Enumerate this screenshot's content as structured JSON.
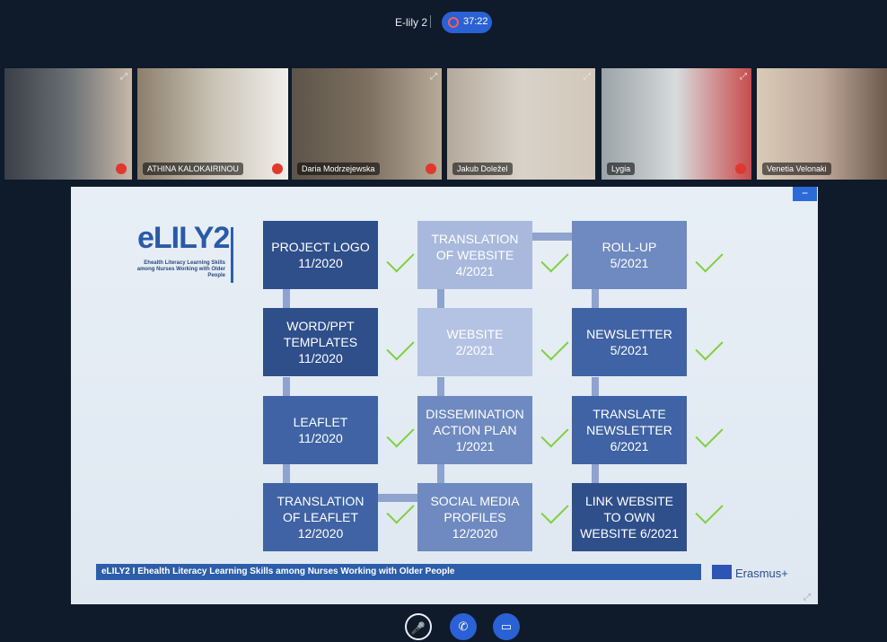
{
  "meeting": {
    "title": "E-lily 2",
    "timer": "37:22"
  },
  "participants": [
    {
      "name": "",
      "has_mic_muted": true
    },
    {
      "name": "ATHINA KALOKAIRINOU",
      "has_mic_muted": true
    },
    {
      "name": "Daria Modrzejewska",
      "has_mic_muted": true
    },
    {
      "name": "Jakub Doležel",
      "has_mic_muted": false
    },
    {
      "name": "Lygia",
      "has_mic_muted": true
    },
    {
      "name": "Venetia Velonaki",
      "has_mic_muted": false
    }
  ],
  "slide": {
    "logo_text": "eLILY2",
    "logo_tagline": "Ehealth Literacy Learning Skills among Nurses Working with Older People",
    "boxes": [
      "PROJECT LOGO\n11/2020",
      "TRANSLATION\nOF WEBSITE\n4/2021",
      "ROLL-UP\n5/2021",
      "WORD/PPT\nTEMPLATES\n11/2020",
      "WEBSITE\n2/2021",
      "NEWSLETTER\n5/2021",
      "LEAFLET\n11/2020",
      "DISSEMINATION\nACTION PLAN\n1/2021",
      "TRANSLATE\nNEWSLETTER\n6/2021",
      "TRANSLATION\nOF LEAFLET\n12/2020",
      "SOCIAL MEDIA\nPROFILES\n12/2020",
      "LINK WEBSITE\nTO OWN\nWEBSITE 6/2021"
    ],
    "footer": "eLILY2 I  Ehealth Literacy Learning Skills among Nurses Working with Older People",
    "erasmus": "Erasmus+"
  },
  "controls": {
    "mic": "mic-muted",
    "phone": "phone",
    "video": "video"
  }
}
